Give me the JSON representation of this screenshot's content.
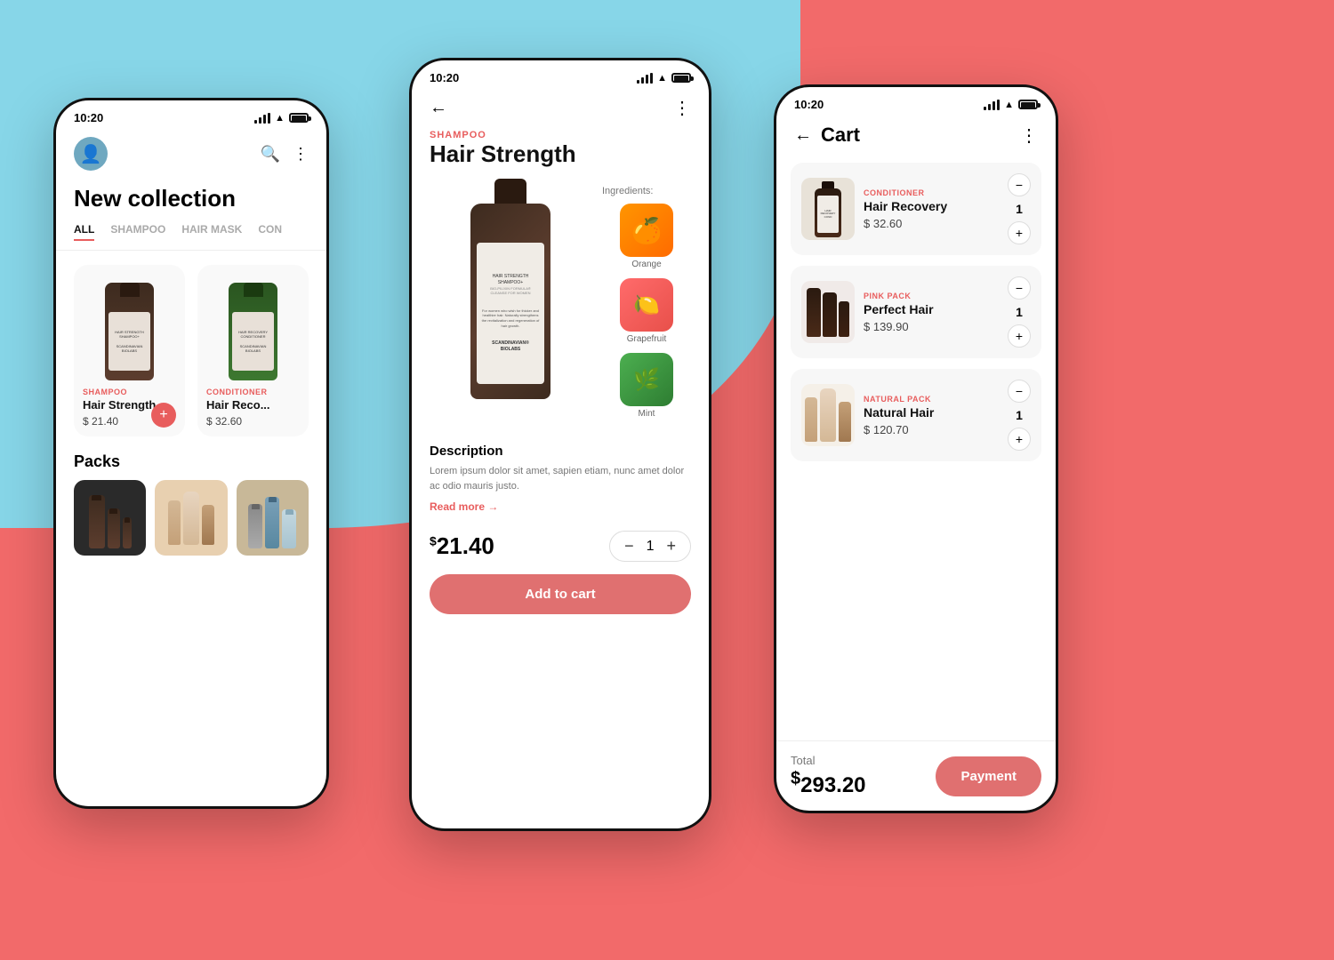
{
  "background": {
    "top_left_color": "#87d6e8",
    "coral_color": "#f26a6a"
  },
  "phone1": {
    "status": {
      "time": "10:20"
    },
    "title": "New collection",
    "tabs": [
      {
        "label": "ALL",
        "active": true
      },
      {
        "label": "SHAMPOO",
        "active": false
      },
      {
        "label": "HAIR MASK",
        "active": false
      },
      {
        "label": "CON",
        "active": false
      }
    ],
    "products": [
      {
        "category": "SHAMPOO",
        "name": "Hair Strength",
        "price": "$ 21.40"
      },
      {
        "category": "CONDITIONER",
        "name": "Hair Reco...",
        "price": "$ 32.60"
      }
    ],
    "packs_title": "Packs"
  },
  "phone2": {
    "status": {
      "time": "10:20"
    },
    "category": "SHAMPOO",
    "product_name": "Hair Strength",
    "ingredients_label": "Ingredients:",
    "ingredients": [
      {
        "name": "Orange",
        "emoji": "🍊"
      },
      {
        "name": "Grapefruit",
        "emoji": "🍋"
      },
      {
        "name": "Mint",
        "emoji": "🌿"
      }
    ],
    "description_title": "Description",
    "description_text": "Lorem ipsum dolor sit amet, sapien etiam, nunc amet dolor ac odio mauris justo.",
    "read_more": "Read more →",
    "price_symbol": "$",
    "price": "21.40",
    "quantity": "1",
    "add_to_cart": "Add to cart"
  },
  "phone3": {
    "status": {
      "time": "10:20"
    },
    "title": "Cart",
    "items": [
      {
        "category": "CONDITIONER",
        "name": "Hair Recovery",
        "price": "$ 32.60",
        "qty": "1"
      },
      {
        "category": "PINK PACK",
        "name": "Perfect Hair",
        "price": "$ 139.90",
        "qty": "1"
      },
      {
        "category": "NATURAL PACK",
        "name": "Natural Hair",
        "price": "$ 120.70",
        "qty": "1"
      }
    ],
    "total_label": "Total",
    "total_symbol": "$",
    "total": "293.20",
    "payment_btn": "Payment"
  }
}
